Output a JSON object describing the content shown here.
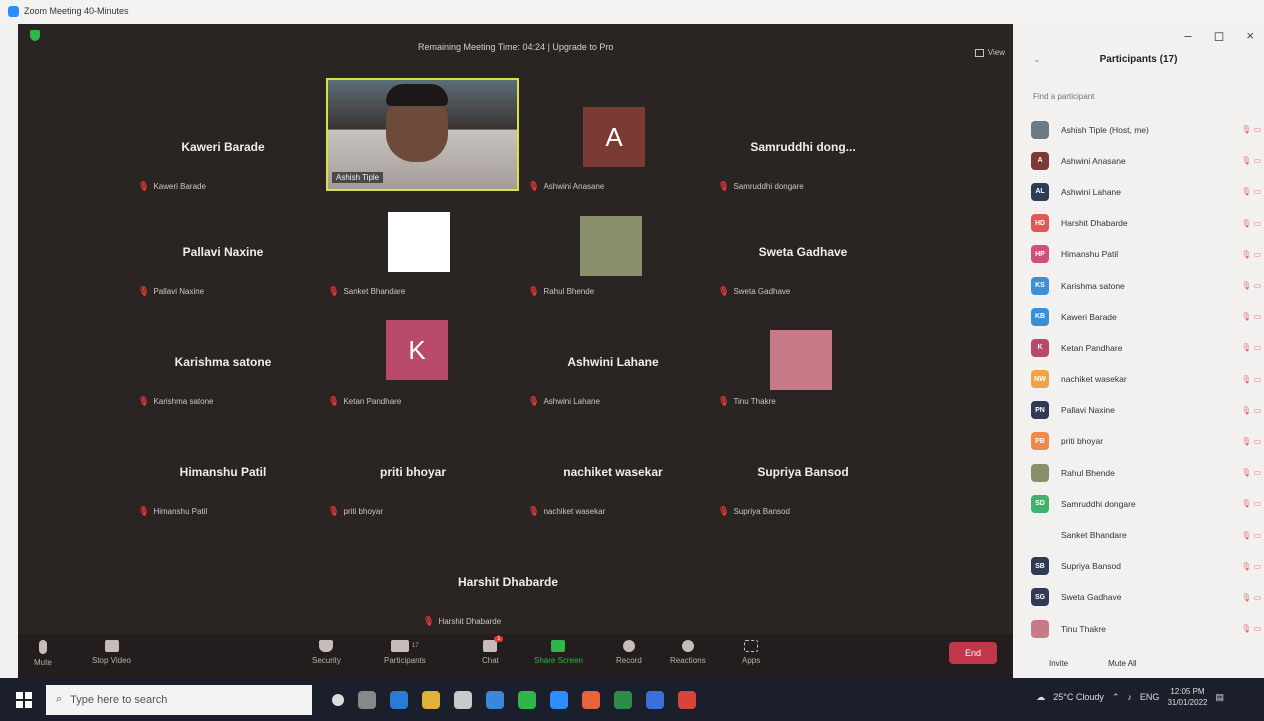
{
  "window": {
    "title": "Zoom Meeting 40-Minutes",
    "controls": [
      "–",
      "◻",
      "×"
    ]
  },
  "meeting": {
    "remaining_text": "Remaining Meeting Time: 04:24 | Upgrade to Pro",
    "view_label": "View",
    "active_speaker_label": "Ashish Tiple",
    "tiles": [
      {
        "center": "Kaweri Barade",
        "sub": "Kaweri Barade",
        "avatar": null
      },
      {
        "center": "",
        "sub": "Ashwini Anasane",
        "avatar": {
          "letter": "A",
          "color": "#7b3a34"
        }
      },
      {
        "center": "Samruddhi dong...",
        "sub": "Samruddhi dongare",
        "avatar": null
      },
      {
        "center": "Pallavi Naxine",
        "sub": "Pallavi Naxine",
        "avatar": null
      },
      {
        "center": "",
        "sub": "Sanket Bhandare",
        "avatar": {
          "letter": "",
          "color": "#ffffff"
        }
      },
      {
        "center": "",
        "sub": "Rahul Bhende",
        "avatar": {
          "letter": "",
          "color": "#8a8f6c"
        }
      },
      {
        "center": "Sweta Gadhave",
        "sub": "Sweta Gadhave",
        "avatar": null
      },
      {
        "center": "Karishma satone",
        "sub": "Karishma satone",
        "avatar": null
      },
      {
        "center": "",
        "sub": "Ketan Pandhare",
        "avatar": {
          "letter": "K",
          "color": "#b94a6c"
        }
      },
      {
        "center": "Ashwini Lahane",
        "sub": "Ashwini Lahane",
        "avatar": null
      },
      {
        "center": "",
        "sub": "Tinu Thakre",
        "avatar": {
          "letter": "",
          "color": "#c77a88"
        }
      },
      {
        "center": "Himanshu Patil",
        "sub": "Himanshu Patil",
        "avatar": null
      },
      {
        "center": "priti bhoyar",
        "sub": "priti bhoyar",
        "avatar": null
      },
      {
        "center": "nachiket wasekar",
        "sub": "nachiket wasekar",
        "avatar": null
      },
      {
        "center": "Supriya Bansod",
        "sub": "Supriya Bansod",
        "avatar": null
      },
      {
        "center": "Harshit Dhabarde",
        "sub": "Harshit Dhabarde",
        "avatar": null
      }
    ],
    "controls": {
      "mute": "Mute",
      "stop_video": "Stop Video",
      "security": "Security",
      "participants": "Participants",
      "participants_count": "17",
      "chat": "Chat",
      "chat_badge": "1",
      "share_screen": "Share Screen",
      "record": "Record",
      "reactions": "Reactions",
      "apps": "Apps",
      "end": "End"
    }
  },
  "panel": {
    "title": "Participants (17)",
    "search_placeholder": "Find a participant",
    "participants": [
      {
        "initials": "",
        "name": "Ashish Tiple (Host, me)",
        "color": "#6d7a86"
      },
      {
        "initials": "A",
        "name": "Ashwini Anasane",
        "color": "#7b3a34"
      },
      {
        "initials": "AL",
        "name": "Ashwini Lahane",
        "color": "#2f3a55"
      },
      {
        "initials": "HD",
        "name": "Harshit Dhabarde",
        "color": "#e0585a"
      },
      {
        "initials": "HP",
        "name": "Himanshu Patil",
        "color": "#d24f7a"
      },
      {
        "initials": "KS",
        "name": "Karishma satone",
        "color": "#3b8fd9"
      },
      {
        "initials": "KB",
        "name": "Kaweri Barade",
        "color": "#3b8fd9"
      },
      {
        "initials": "K",
        "name": "Ketan Pandhare",
        "color": "#b94a6c"
      },
      {
        "initials": "NW",
        "name": "nachiket wasekar",
        "color": "#f0a24a"
      },
      {
        "initials": "PN",
        "name": "Pallavi Naxine",
        "color": "#2f3a55"
      },
      {
        "initials": "PB",
        "name": "priti bhoyar",
        "color": "#f08a4a"
      },
      {
        "initials": "",
        "name": "Rahul Bhende",
        "color": "#8a8f6c"
      },
      {
        "initials": "SD",
        "name": "Samruddhi dongare",
        "color": "#3fb36a"
      },
      {
        "initials": "",
        "name": "Sanket Bhandare",
        "color": "#f3f1ef"
      },
      {
        "initials": "SB",
        "name": "Supriya Bansod",
        "color": "#2f3a55"
      },
      {
        "initials": "SG",
        "name": "Sweta Gadhave",
        "color": "#2f3a55"
      },
      {
        "initials": "",
        "name": "Tinu Thakre",
        "color": "#c77a88"
      }
    ],
    "invite": "Invite",
    "mute_all": "Mute All"
  },
  "taskbar": {
    "search_placeholder": "Type here to search",
    "weather": "25°C Cloudy",
    "lang": "ENG",
    "time": "12:05 PM",
    "date": "31/01/2022"
  }
}
